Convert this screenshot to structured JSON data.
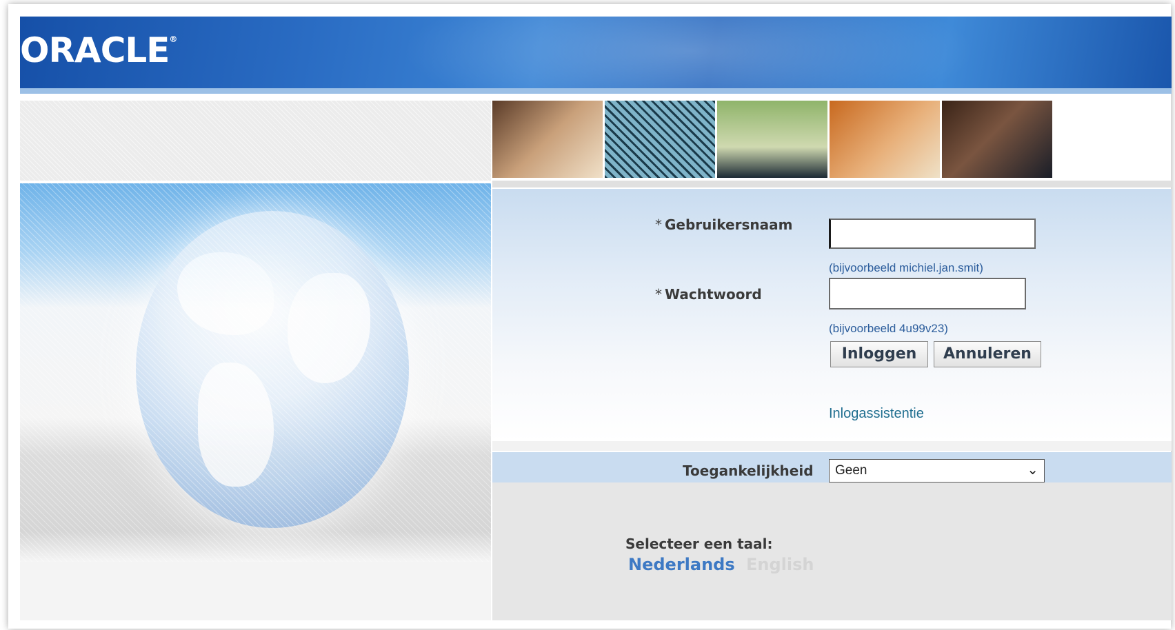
{
  "header": {
    "logo_text": "ORACLE"
  },
  "login": {
    "username_label": "Gebruikersnaam",
    "username_value": "",
    "username_hint": "(bijvoorbeeld michiel.jan.smit)",
    "password_label": "Wachtwoord",
    "password_value": "",
    "password_hint": "(bijvoorbeeld 4u99v23)",
    "required_marker": "*",
    "login_button": "Inloggen",
    "cancel_button": "Annuleren",
    "help_link": "Inlogassistentie"
  },
  "accessibility": {
    "label": "Toegankelijkheid",
    "selected": "Geen"
  },
  "language": {
    "title": "Selecteer een taal:",
    "options": [
      "Nederlands",
      "English"
    ],
    "active": "Nederlands"
  },
  "colors": {
    "banner": "#2a6cc3",
    "link": "#1f6e8f",
    "hint": "#2c5d9c",
    "active_language": "#3d79c4"
  }
}
